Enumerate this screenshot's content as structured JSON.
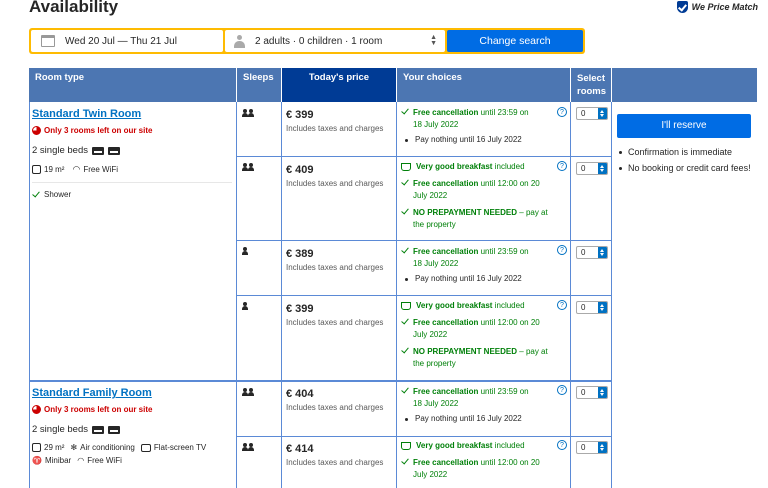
{
  "header": {
    "title": "Availability",
    "price_match": "We Price Match"
  },
  "search": {
    "dates": "Wed 20 Jul — Thu 21 Jul",
    "occupancy": "2 adults · 0 children · 1 room",
    "button": "Change search"
  },
  "table": {
    "headers": {
      "room_type": "Room type",
      "sleeps": "Sleeps",
      "price": "Today's price",
      "choices": "Your choices",
      "select_rooms": "Select rooms"
    }
  },
  "rooms": [
    {
      "name": "Standard Twin Room",
      "urgency": "Only 3 rooms left on our site",
      "beds": "2 single beds",
      "size": "19 m²",
      "facilities": [
        "Free WiFi"
      ],
      "extra": "Shower"
    },
    {
      "name": "Standard Family Room",
      "urgency": "Only 3 rooms left on our site",
      "beds": "2 single beds",
      "size": "29 m²",
      "facilities": [
        "Air conditioning",
        "Flat-screen TV",
        "Minibar",
        "Free WiFi"
      ]
    }
  ],
  "options": [
    {
      "price": "€ 399",
      "tax": "Includes taxes and charges",
      "sleeps": 2,
      "qty": "0"
    },
    {
      "price": "€ 409",
      "tax": "Includes taxes and charges",
      "sleeps": 2,
      "qty": "0"
    },
    {
      "price": "€ 389",
      "tax": "Includes taxes and charges",
      "sleeps": 1,
      "qty": "0"
    },
    {
      "price": "€ 399",
      "tax": "Includes taxes and charges",
      "sleeps": 1,
      "qty": "0"
    },
    {
      "price": "€ 404",
      "tax": "Includes taxes and charges",
      "sleeps": 2,
      "qty": "0"
    },
    {
      "price": "€ 414",
      "tax": "Includes taxes and charges",
      "sleeps": 2,
      "qty": "0"
    }
  ],
  "choices": {
    "free_cancel_label": "Free cancellation",
    "until_2359": "until 23:59 on",
    "date_18": "18 July 2022",
    "until_1200": "until 12:00 on 20",
    "date_20": "July 2022",
    "pay_nothing": "Pay nothing until 16 July 2022",
    "breakfast_label": "Very good breakfast",
    "included": "included",
    "noprepay_label": "NO PREPAYMENT NEEDED",
    "pay_at": "– pay at",
    "the_property": "the property"
  },
  "reserve": {
    "button": "I'll reserve",
    "bullets": [
      "Confirmation is immediate",
      "No booking or credit card fees!"
    ]
  }
}
